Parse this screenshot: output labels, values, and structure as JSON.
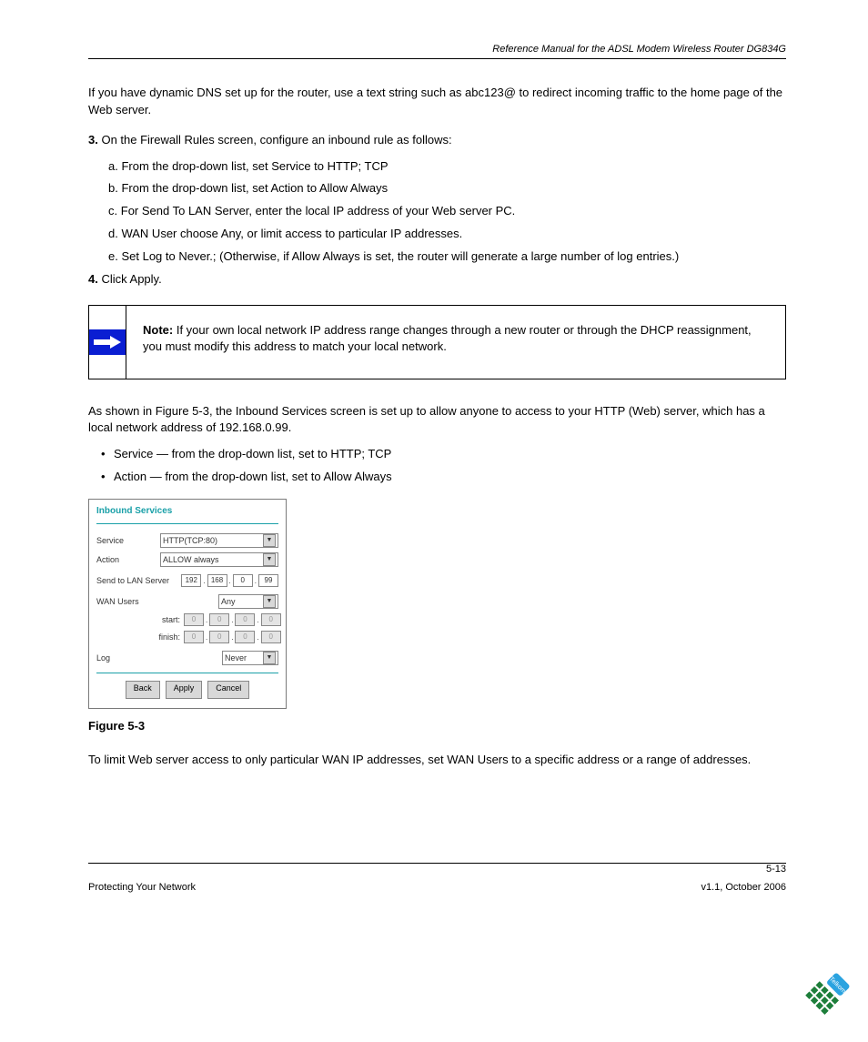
{
  "header": {
    "manual_title": "Reference Manual for the ADSL Modem Wireless Router DG834G"
  },
  "intro_para": "If you have dynamic DNS set up for the router, use a text string such as abc123@ to redirect incoming traffic to the home page of the Web server.",
  "steps": {
    "s3_a": {
      "num": "3.",
      "lead": "On the Firewall Rules screen, configure an inbound rule as follows:"
    },
    "s3_items": {
      "a": {
        "num": "a.",
        "text": "From the drop-down list, set Service to HTTP; TCP"
      },
      "b": {
        "num": "b.",
        "text": "From the drop-down list, set Action to Allow Always"
      },
      "c": {
        "num": "c.",
        "text": "For Send To LAN Server, enter the local IP address of your Web server PC."
      },
      "d": {
        "num": "d.",
        "text": "WAN User choose Any, or limit access to particular IP addresses."
      },
      "e": {
        "num": "e.",
        "text": "Set Log to Never.; (Otherwise, if Allow Always is set, the router will generate a large number of log entries.)"
      }
    },
    "s4": {
      "num": "4.",
      "text": "Click Apply."
    }
  },
  "note": {
    "label": "Note:",
    "text": "If your own local network IP address range changes through a new router or through the DHCP reassignment, you must modify this address to match your local network."
  },
  "example_intro": "As shown in Figure 5-3, the Inbound Services screen is set up to allow anyone to access to your HTTP (Web) server, which has a local network address of 192.168.0.99.",
  "bullets": {
    "b1": "Service — from the drop-down list, set to HTTP; TCP",
    "b2": "Action — from the drop-down list, set to Allow Always"
  },
  "screenshot": {
    "title": "Inbound Services",
    "labels": {
      "service": "Service",
      "action": "Action",
      "send_to": "Send to LAN Server",
      "wan_users": "WAN Users",
      "start": "start:",
      "finish": "finish:",
      "log": "Log"
    },
    "values": {
      "service": "HTTP(TCP:80)",
      "action": "ALLOW always",
      "ip": [
        "192",
        "168",
        "0",
        "99"
      ],
      "wan": "Any",
      "start_ip": [
        "0",
        "0",
        "0",
        "0"
      ],
      "finish_ip": [
        "0",
        "0",
        "0",
        "0"
      ],
      "log": "Never"
    },
    "buttons": {
      "back": "Back",
      "apply": "Apply",
      "cancel": "Cancel"
    }
  },
  "figure_caption": "Figure 5-3",
  "after_fig": "To limit Web server access to only particular WAN IP addresses, set WAN Users to a specific address or a range of addresses.",
  "footer": {
    "left": "Protecting Your Network",
    "right_pagenum": "5-13",
    "right_version": "v1.1, October 2006"
  }
}
